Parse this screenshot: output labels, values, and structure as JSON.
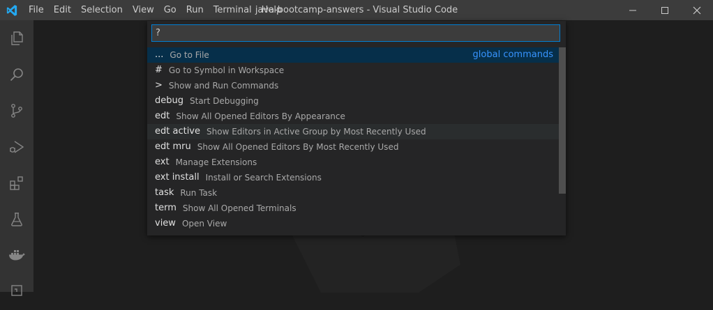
{
  "window": {
    "title": "java-bootcamp-answers - Visual Studio Code"
  },
  "menu": [
    "File",
    "Edit",
    "Selection",
    "View",
    "Go",
    "Run",
    "Terminal",
    "Help"
  ],
  "activity_icons": [
    "explorer-icon",
    "search-icon",
    "source-control-icon",
    "run-debug-icon",
    "extensions-icon",
    "testing-icon",
    "docker-icon",
    "remote-explorer-icon"
  ],
  "quick_open": {
    "input_value": "?",
    "items": [
      {
        "prefix": "...",
        "description": "Go to File",
        "detail": "global commands",
        "state": "selected"
      },
      {
        "prefix": "#",
        "description": "Go to Symbol in Workspace",
        "detail": "",
        "state": ""
      },
      {
        "prefix": ">",
        "description": "Show and Run Commands",
        "detail": "",
        "state": ""
      },
      {
        "prefix": "debug",
        "description": "Start Debugging",
        "detail": "",
        "state": ""
      },
      {
        "prefix": "edt",
        "description": "Show All Opened Editors By Appearance",
        "detail": "",
        "state": ""
      },
      {
        "prefix": "edt active",
        "description": "Show Editors in Active Group by Most Recently Used",
        "detail": "",
        "state": "hover"
      },
      {
        "prefix": "edt mru",
        "description": "Show All Opened Editors By Most Recently Used",
        "detail": "",
        "state": ""
      },
      {
        "prefix": "ext",
        "description": "Manage Extensions",
        "detail": "",
        "state": ""
      },
      {
        "prefix": "ext install",
        "description": "Install or Search Extensions",
        "detail": "",
        "state": ""
      },
      {
        "prefix": "task",
        "description": "Run Task",
        "detail": "",
        "state": ""
      },
      {
        "prefix": "term",
        "description": "Show All Opened Terminals",
        "detail": "",
        "state": ""
      },
      {
        "prefix": "view",
        "description": "Open View",
        "detail": "",
        "state": ""
      }
    ]
  },
  "colors": {
    "accent": "#007fd4",
    "selected_bg": "#062f4a",
    "detail_text": "#3794ff"
  }
}
